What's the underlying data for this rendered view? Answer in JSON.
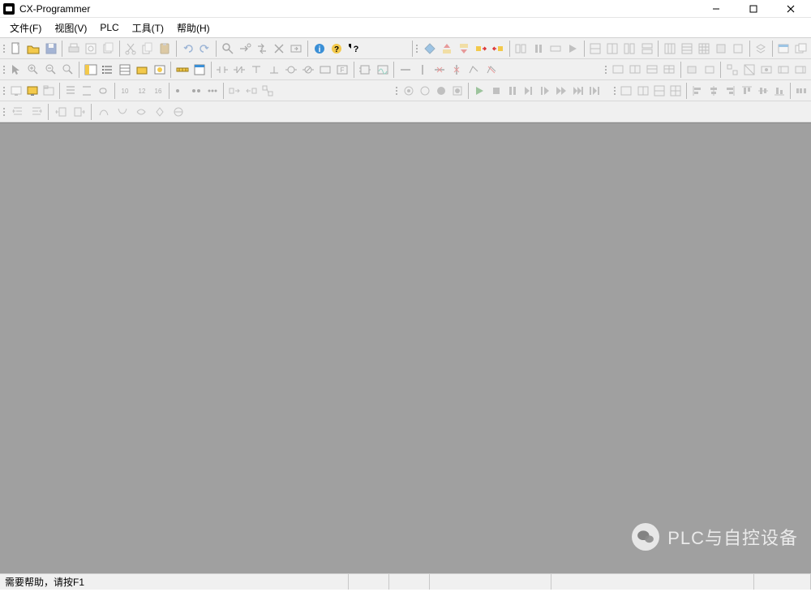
{
  "window": {
    "title": "CX-Programmer"
  },
  "menu": {
    "file": "文件(F)",
    "view": "视图(V)",
    "plc": "PLC",
    "tools": "工具(T)",
    "help": "帮助(H)"
  },
  "icons": {
    "r1": [
      "new",
      "open",
      "save",
      "print",
      "preview",
      "print2",
      "cut",
      "copy",
      "paste",
      "undo",
      "redo",
      "find",
      "find-next",
      "replace",
      "delete",
      "goto",
      "info",
      "help",
      "ctx-help"
    ],
    "r1b": [
      "flag-up",
      "flag-dn",
      "flag-g",
      "stack-y",
      "stack-g",
      "step-in",
      "pause",
      "step-over",
      "step-out",
      "net1",
      "net2",
      "net3",
      "net4",
      "grid1",
      "grid2",
      "grid3",
      "grid4",
      "grid5",
      "layer",
      "win1",
      "win2"
    ],
    "r2": [
      "cur",
      "zin",
      "zout",
      "zfit",
      "tree",
      "list",
      "props",
      "out1",
      "out2",
      "ruler",
      "mark",
      "step-l",
      "branch-d",
      "branch-u",
      "coil",
      "coil-n",
      "jump",
      "label",
      "fbd",
      "scope",
      "hline",
      "vline"
    ],
    "r2b": [
      "scr1",
      "scr2",
      "scr3",
      "scr4",
      "scr5",
      "scr6",
      "scr7",
      "scr8",
      "scr9",
      "scr10",
      "scr11"
    ],
    "r3": [
      "mon1",
      "mon2",
      "tab",
      "bar1",
      "bar2",
      "link",
      "n10",
      "n12",
      "n16",
      "dot1",
      "dot2",
      "dot3",
      "t1",
      "t2",
      "t3"
    ],
    "r3b": [
      "dbg1",
      "dbg2",
      "dbg3",
      "dbg4",
      "play",
      "stop",
      "rec",
      "next",
      "end",
      "fwd",
      "ffwd",
      "last"
    ],
    "r3c": [
      "w1",
      "w2",
      "w3",
      "w4",
      "aL",
      "aC",
      "aR",
      "aT",
      "aM",
      "aB",
      "dist"
    ],
    "r4": [
      "indL",
      "indR",
      "outL",
      "outR",
      "c1",
      "c2",
      "c3",
      "c4",
      "c5"
    ]
  },
  "status": {
    "help_hint": "需要帮助，请按F1"
  },
  "watermark": {
    "text": "PLC与自控设备"
  }
}
